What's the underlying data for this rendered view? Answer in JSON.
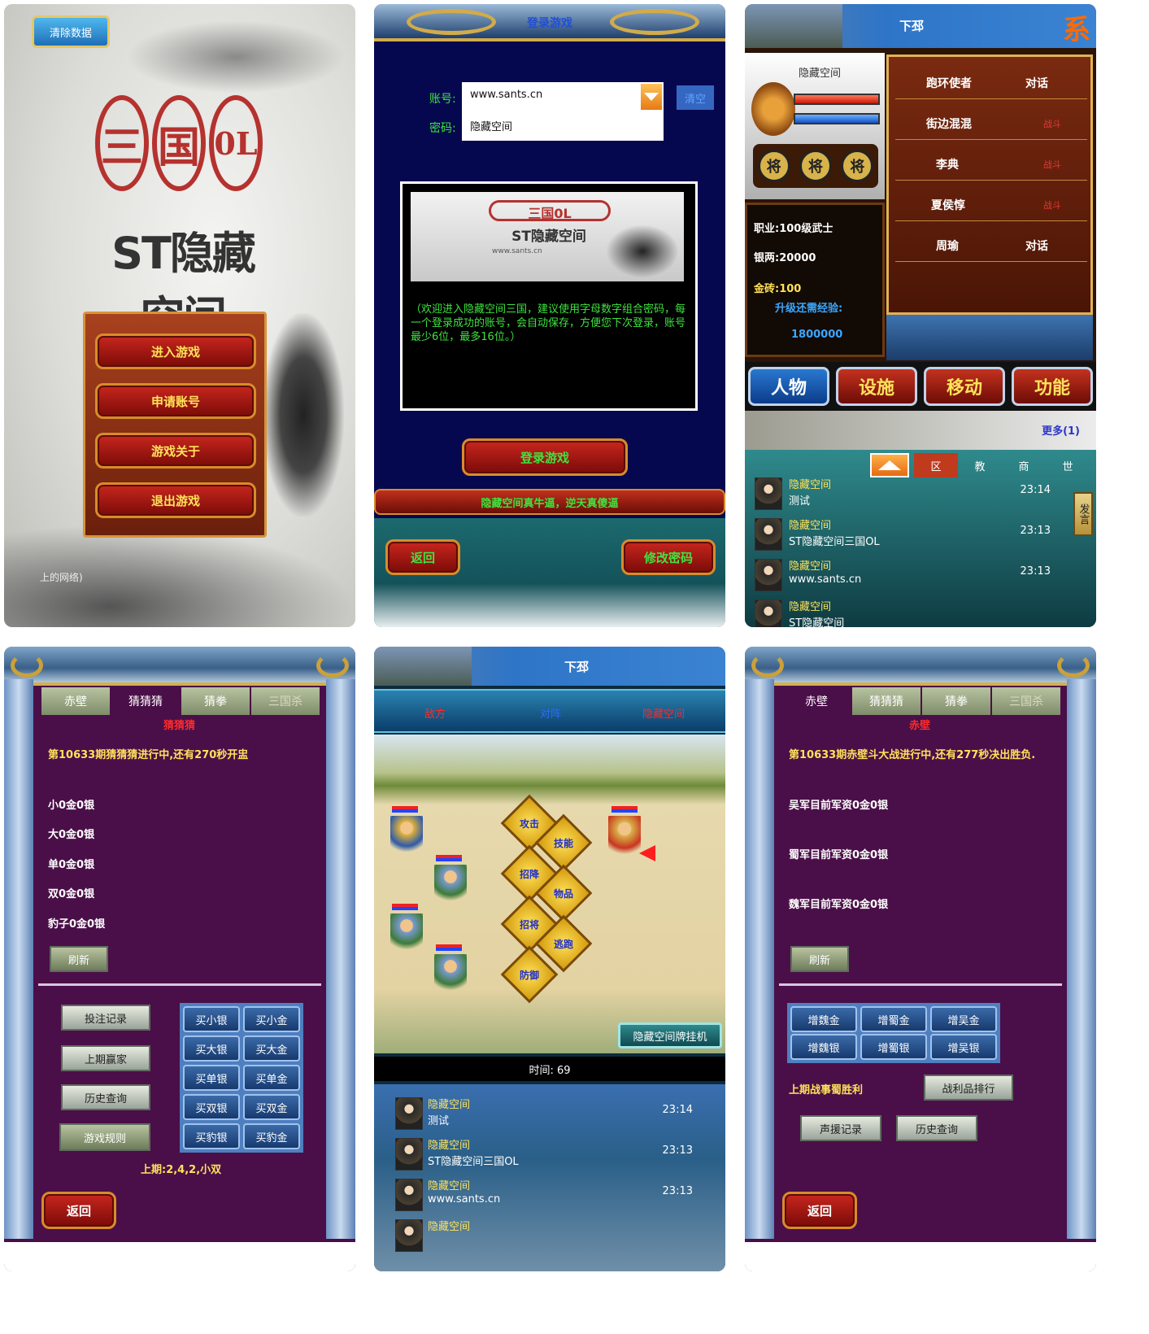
{
  "p1": {
    "clear_button": "清除数据",
    "logo_chars": [
      "三",
      "国",
      "0L"
    ],
    "title": "ST隐藏空间",
    "menu": [
      "进入游戏",
      "申请账号",
      "游戏关于",
      "退出游戏"
    ],
    "footer": "上的网络)"
  },
  "p2": {
    "header": "登录游戏",
    "account_label": "账号:",
    "account_value": "www.sants.cn",
    "password_label": "密码:",
    "password_value": "隐藏空间",
    "clear_button": "清空",
    "banner_logo": "三国0L",
    "banner_title": "ST隐藏空间",
    "banner_url": "www.sants.cn",
    "notice": "（欢迎进入隐藏空间三国，建议使用字母数字组合密码，每一个登录成功的账号，会自动保存，方便您下次登录，账号最少6位，最多16位。）",
    "login_button": "登录游戏",
    "marquee": "隐藏空间真牛逼，逆天真傻逼",
    "back_button": "返回",
    "change_pwd_button": "修改密码"
  },
  "p3": {
    "location": "下邳",
    "sys_icon": "系",
    "player_name": "隐藏空间",
    "general_icons": [
      "将",
      "将",
      "将"
    ],
    "career": "职业:100级武士",
    "silver": "银两:20000",
    "gold": "金砖:100",
    "exp_label": "升级还需经验:",
    "exp_value": "1800000",
    "npcs": [
      {
        "name": "跑环使者",
        "action": "对话"
      },
      {
        "name": "街边混混",
        "action": "战斗"
      },
      {
        "name": "李典",
        "action": "战斗"
      },
      {
        "name": "夏侯惇",
        "action": "战斗"
      },
      {
        "name": "周瑜",
        "action": "对话"
      }
    ],
    "menu_tabs": [
      "人物",
      "设施",
      "移动",
      "功能"
    ],
    "more": "更多(1)",
    "chat_tabs": [
      "区",
      "教",
      "商",
      "世"
    ],
    "speak": "发言",
    "chat": [
      {
        "name": "隐藏空间",
        "msg": "测试",
        "time": "23:14"
      },
      {
        "name": "隐藏空间",
        "msg": "ST隐藏空间三国OL",
        "time": "23:13"
      },
      {
        "name": "隐藏空间",
        "msg": "www.sants.cn",
        "time": "23:13"
      },
      {
        "name": "隐藏空间",
        "msg": "ST隐藏空间",
        "time": ""
      }
    ]
  },
  "p4": {
    "tabs": [
      "赤壁",
      "猜猜猜",
      "猜拳",
      "三国杀"
    ],
    "section_title": "猜猜猜",
    "status": "第10633期猜猜猜进行中,还有270秒开盅",
    "bets": [
      "小0金0银",
      "大0金0银",
      "单0金0银",
      "双0金0银",
      "豹子0金0银"
    ],
    "refresh": "刷新",
    "side_buttons": [
      "投注记录",
      "上期赢家",
      "历史查询",
      "游戏规则"
    ],
    "bet_buttons": [
      [
        "买小银",
        "买小金"
      ],
      [
        "买大银",
        "买大金"
      ],
      [
        "买单银",
        "买单金"
      ],
      [
        "买双银",
        "买双金"
      ],
      [
        "买豹银",
        "买豹金"
      ]
    ],
    "last_result": "上期:2,4,2,小双",
    "back": "返回"
  },
  "p5": {
    "location": "下邳",
    "enemy": "敌方",
    "vs": "对阵",
    "self": "隐藏空间",
    "actions": [
      "攻击",
      "技能",
      "招降",
      "物品",
      "招将",
      "逃跑",
      "防御"
    ],
    "auto_button": "隐藏空间牌挂机",
    "timer": "时间: 69",
    "chat": [
      {
        "name": "隐藏空间",
        "msg": "测试",
        "time": "23:14"
      },
      {
        "name": "隐藏空间",
        "msg": "ST隐藏空间三国OL",
        "time": "23:13"
      },
      {
        "name": "隐藏空间",
        "msg": "www.sants.cn",
        "time": "23:13"
      },
      {
        "name": "隐藏空间",
        "msg": "",
        "time": ""
      }
    ]
  },
  "p6": {
    "tabs": [
      "赤壁",
      "猜猜猜",
      "猜拳",
      "三国杀"
    ],
    "section_title": "赤壁",
    "status": "第10633期赤壁斗大战进行中,还有277秒决出胜负.",
    "funds": [
      "吴军目前军资0金0银",
      "蜀军目前军资0金0银",
      "魏军目前军资0金0银"
    ],
    "refresh": "刷新",
    "add_buttons": [
      [
        "增魏金",
        "增蜀金",
        "增吴金"
      ],
      [
        "增魏银",
        "增蜀银",
        "增吴银"
      ]
    ],
    "last_battle": "上期战事蜀胜利",
    "ranking": "战利品排行",
    "support_record": "声援记录",
    "history": "历史查询",
    "back": "返回"
  }
}
